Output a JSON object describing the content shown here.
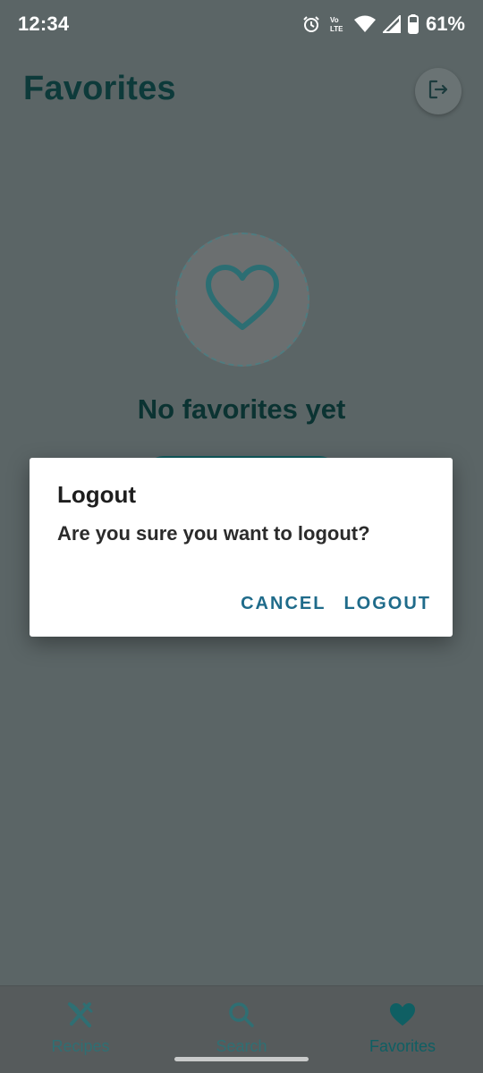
{
  "status_bar": {
    "time": "12:34",
    "battery": "61%",
    "icons": [
      "alarm-icon",
      "volte-icon",
      "wifi-icon",
      "signal-icon",
      "battery-icon"
    ]
  },
  "header": {
    "title": "Favorites",
    "logout_icon": "logout-icon"
  },
  "empty_state": {
    "icon": "heart-outline-icon",
    "title": "No favorites yet"
  },
  "dialog": {
    "title": "Logout",
    "message": "Are you sure you want to logout?",
    "cancel_label": "CANCEL",
    "confirm_label": "LOGOUT"
  },
  "bottom_nav": {
    "items": [
      {
        "label": "Recipes",
        "icon": "fork-knife-icon",
        "active": false
      },
      {
        "label": "Search",
        "icon": "search-icon",
        "active": false
      },
      {
        "label": "Favorites",
        "icon": "heart-icon",
        "active": true
      }
    ]
  },
  "colors": {
    "scrim_background": "#5b6566",
    "title_text": "#0d3a3a",
    "dialog_action": "#1f6b8a",
    "nav_active": "#0f5f63",
    "nav_inactive": "#2f6f73"
  }
}
